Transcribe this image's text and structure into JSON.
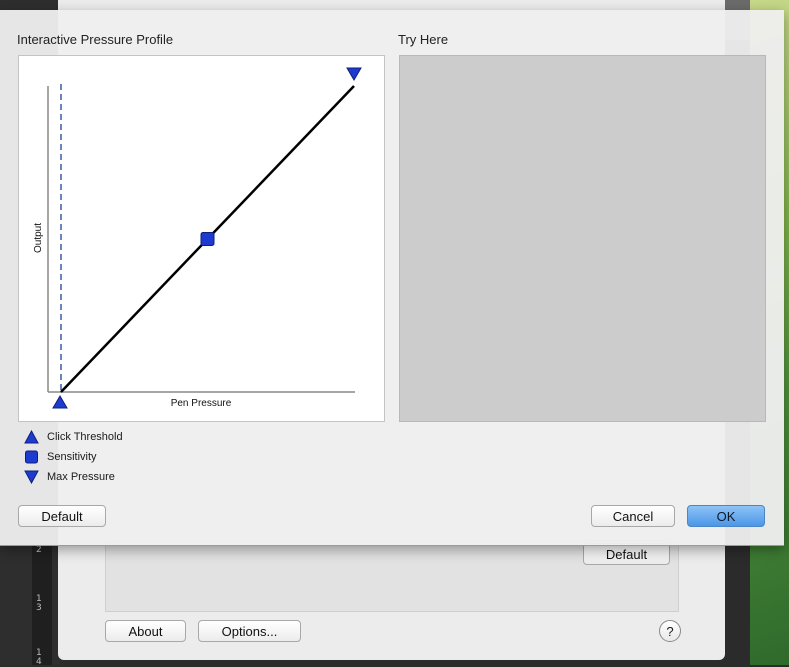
{
  "sheet": {
    "profile_title": "Interactive Pressure Profile",
    "try_title": "Try Here",
    "graph": {
      "x_label": "Pen Pressure",
      "y_label": "Output",
      "click_threshold": 0.0,
      "sensitivity": 0.5,
      "max_pressure": 1.0
    },
    "legend": [
      {
        "icon": "up-triangle-icon",
        "label": "Click Threshold"
      },
      {
        "icon": "square-icon",
        "label": "Sensitivity"
      },
      {
        "icon": "down-triangle-icon",
        "label": "Max Pressure"
      }
    ],
    "buttons": {
      "default": "Default",
      "cancel": "Cancel",
      "ok": "OK"
    }
  },
  "under_window": {
    "default_button": "Default",
    "about_button": "About",
    "options_button": "Options...",
    "help_button": "?"
  },
  "ruler_numbers": [
    "2",
    "1",
    "3",
    "1",
    "4"
  ],
  "colors": {
    "marker": "#1e3bd0",
    "ok_button": "#4b96e8",
    "try_area": "#cccccc"
  }
}
